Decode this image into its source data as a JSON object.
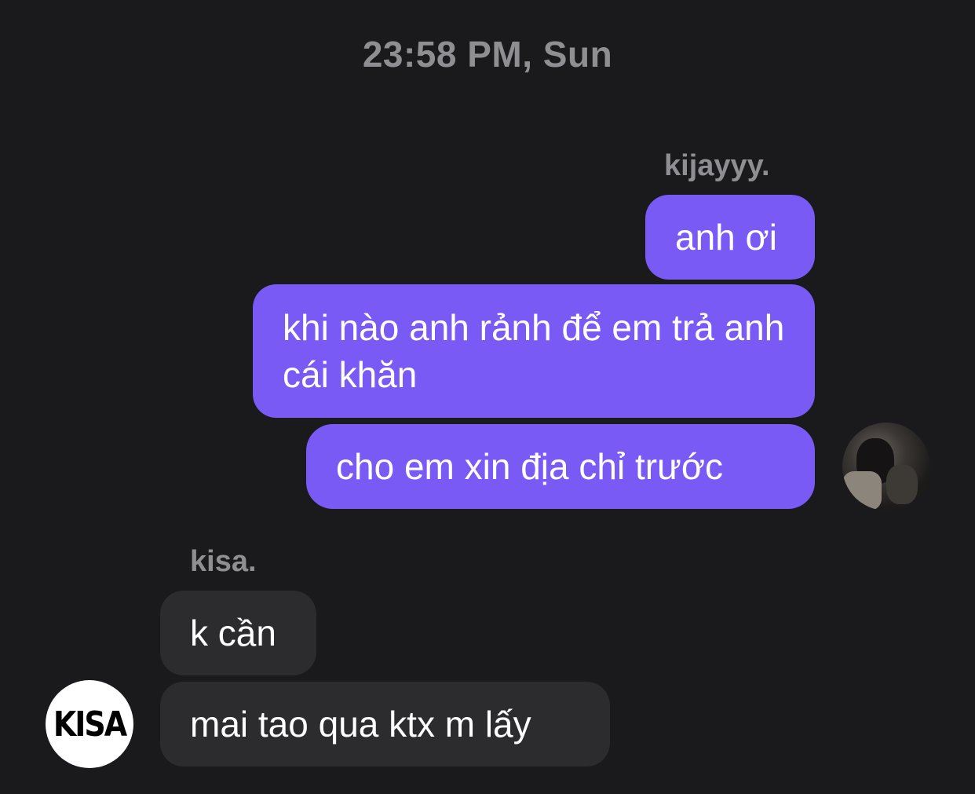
{
  "conversation": {
    "timestamp": "23:58 PM, Sun",
    "outgoing_sender": "kijayyy.",
    "incoming_sender": "kisa.",
    "outgoing_messages": [
      {
        "text": "anh ơi"
      },
      {
        "text": "khi nào anh rảnh để em trả anh cái khăn"
      },
      {
        "text": "cho em xin địa chỉ trước"
      }
    ],
    "incoming_messages": [
      {
        "text": "k cần"
      },
      {
        "text": "mai tao qua ktx m lấy"
      }
    ],
    "incoming_avatar_text": "KISA"
  },
  "colors": {
    "background": "#1a1a1d",
    "outgoing_bubble": "#7a5af5",
    "incoming_bubble": "#2c2c2f",
    "meta_text": "#8e8e93"
  }
}
